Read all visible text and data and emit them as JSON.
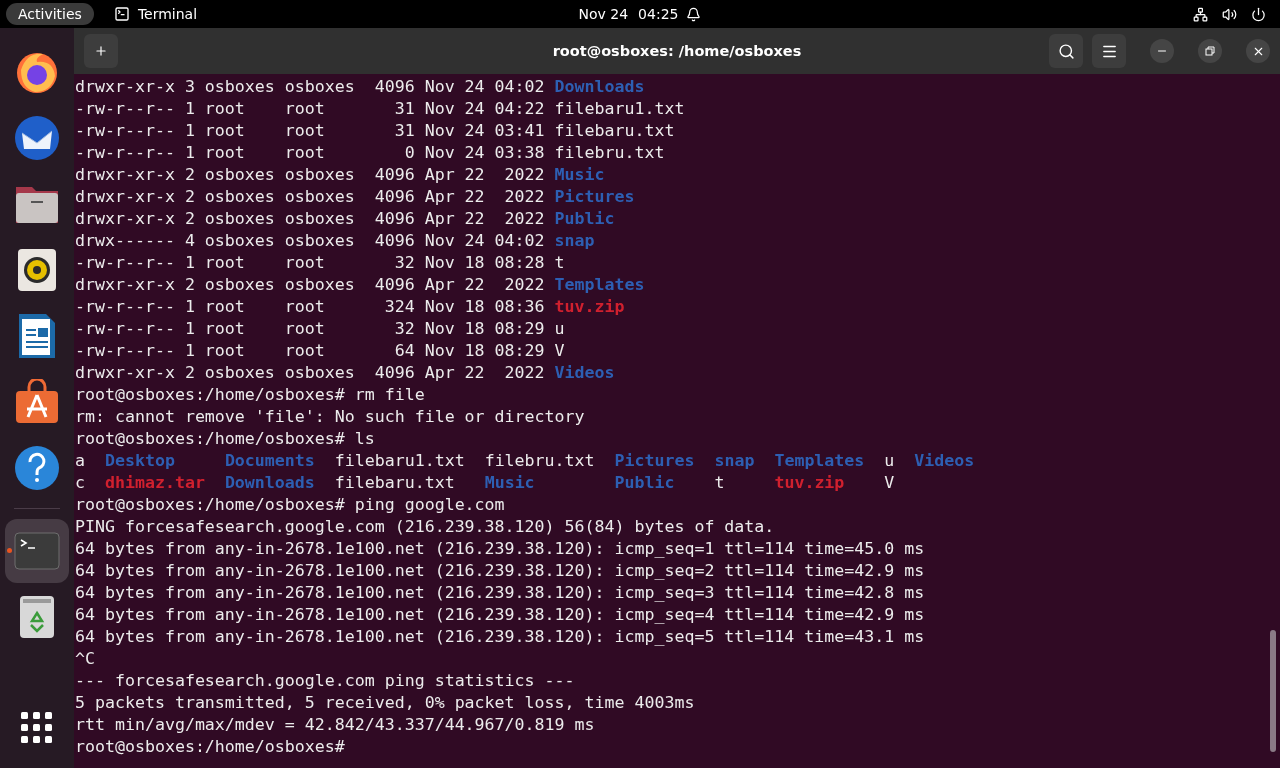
{
  "top_bar": {
    "activities": "Activities",
    "app_name": "Terminal",
    "date": "Nov 24",
    "time": "04:25"
  },
  "dock": {
    "items": [
      {
        "kind": "browser",
        "selected": false
      },
      {
        "kind": "mail",
        "selected": false
      },
      {
        "kind": "files",
        "selected": false
      },
      {
        "kind": "music",
        "selected": false
      },
      {
        "kind": "writer",
        "selected": false
      },
      {
        "kind": "store",
        "selected": false
      },
      {
        "kind": "help",
        "selected": false
      },
      {
        "kind": "terminal",
        "selected": true
      },
      {
        "kind": "trash",
        "selected": false
      }
    ]
  },
  "window": {
    "title": "root@osboxes: /home/osboxes"
  },
  "terminal": {
    "lines": [
      [
        {
          "text": "drwxr-xr-x 3 osboxes osboxes  4096 Nov 24 04:02 ",
          "kind": "plain"
        },
        {
          "text": "Downloads",
          "kind": "dir"
        }
      ],
      [
        {
          "text": "-rw-r--r-- 1 root    root       31 Nov 24 04:22 filebaru1.txt",
          "kind": "plain"
        }
      ],
      [
        {
          "text": "-rw-r--r-- 1 root    root       31 Nov 24 03:41 filebaru.txt",
          "kind": "plain"
        }
      ],
      [
        {
          "text": "-rw-r--r-- 1 root    root        0 Nov 24 03:38 filebru.txt",
          "kind": "plain"
        }
      ],
      [
        {
          "text": "drwxr-xr-x 2 osboxes osboxes  4096 Apr 22  2022 ",
          "kind": "plain"
        },
        {
          "text": "Music",
          "kind": "dir"
        }
      ],
      [
        {
          "text": "drwxr-xr-x 2 osboxes osboxes  4096 Apr 22  2022 ",
          "kind": "plain"
        },
        {
          "text": "Pictures",
          "kind": "dir"
        }
      ],
      [
        {
          "text": "drwxr-xr-x 2 osboxes osboxes  4096 Apr 22  2022 ",
          "kind": "plain"
        },
        {
          "text": "Public",
          "kind": "dir"
        }
      ],
      [
        {
          "text": "drwx------ 4 osboxes osboxes  4096 Nov 24 04:02 ",
          "kind": "plain"
        },
        {
          "text": "snap",
          "kind": "dir"
        }
      ],
      [
        {
          "text": "-rw-r--r-- 1 root    root       32 Nov 18 08:28 t",
          "kind": "plain"
        }
      ],
      [
        {
          "text": "drwxr-xr-x 2 osboxes osboxes  4096 Apr 22  2022 ",
          "kind": "plain"
        },
        {
          "text": "Templates",
          "kind": "dir"
        }
      ],
      [
        {
          "text": "-rw-r--r-- 1 root    root      324 Nov 18 08:36 ",
          "kind": "plain"
        },
        {
          "text": "tuv.zip",
          "kind": "archive"
        }
      ],
      [
        {
          "text": "-rw-r--r-- 1 root    root       32 Nov 18 08:29 u",
          "kind": "plain"
        }
      ],
      [
        {
          "text": "-rw-r--r-- 1 root    root       64 Nov 18 08:29 V",
          "kind": "plain"
        }
      ],
      [
        {
          "text": "drwxr-xr-x 2 osboxes osboxes  4096 Apr 22  2022 ",
          "kind": "plain"
        },
        {
          "text": "Videos",
          "kind": "dir"
        }
      ],
      [
        {
          "text": "root@osboxes:/home/osboxes# rm file",
          "kind": "plain"
        }
      ],
      [
        {
          "text": "rm: cannot remove 'file': No such file or directory",
          "kind": "plain"
        }
      ],
      [
        {
          "text": "root@osboxes:/home/osboxes# ls",
          "kind": "plain"
        }
      ],
      [
        {
          "text": "a  ",
          "kind": "plain"
        },
        {
          "text": "Desktop     ",
          "kind": "dir"
        },
        {
          "text": "Documents  ",
          "kind": "dir"
        },
        {
          "text": "filebaru1.txt  ",
          "kind": "plain"
        },
        {
          "text": "filebru.txt  ",
          "kind": "plain"
        },
        {
          "text": "Pictures  ",
          "kind": "dir"
        },
        {
          "text": "snap  ",
          "kind": "dir"
        },
        {
          "text": "Templates  ",
          "kind": "dir"
        },
        {
          "text": "u  ",
          "kind": "plain"
        },
        {
          "text": "Videos",
          "kind": "dir"
        }
      ],
      [
        {
          "text": "c  ",
          "kind": "plain"
        },
        {
          "text": "dhimaz.tar  ",
          "kind": "archive"
        },
        {
          "text": "Downloads  ",
          "kind": "dir"
        },
        {
          "text": "filebaru.txt   ",
          "kind": "plain"
        },
        {
          "text": "Music        ",
          "kind": "dir"
        },
        {
          "text": "Public    ",
          "kind": "dir"
        },
        {
          "text": "t     ",
          "kind": "plain"
        },
        {
          "text": "tuv.zip    ",
          "kind": "archive"
        },
        {
          "text": "V",
          "kind": "plain"
        }
      ],
      [
        {
          "text": "root@osboxes:/home/osboxes# ping google.com",
          "kind": "plain"
        }
      ],
      [
        {
          "text": "PING forcesafesearch.google.com (216.239.38.120) 56(84) bytes of data.",
          "kind": "plain"
        }
      ],
      [
        {
          "text": "64 bytes from any-in-2678.1e100.net (216.239.38.120): icmp_seq=1 ttl=114 time=45.0 ms",
          "kind": "plain"
        }
      ],
      [
        {
          "text": "64 bytes from any-in-2678.1e100.net (216.239.38.120): icmp_seq=2 ttl=114 time=42.9 ms",
          "kind": "plain"
        }
      ],
      [
        {
          "text": "64 bytes from any-in-2678.1e100.net (216.239.38.120): icmp_seq=3 ttl=114 time=42.8 ms",
          "kind": "plain"
        }
      ],
      [
        {
          "text": "64 bytes from any-in-2678.1e100.net (216.239.38.120): icmp_seq=4 ttl=114 time=42.9 ms",
          "kind": "plain"
        }
      ],
      [
        {
          "text": "64 bytes from any-in-2678.1e100.net (216.239.38.120): icmp_seq=5 ttl=114 time=43.1 ms",
          "kind": "plain"
        }
      ],
      [
        {
          "text": "^C",
          "kind": "plain"
        }
      ],
      [
        {
          "text": "--- forcesafesearch.google.com ping statistics ---",
          "kind": "plain"
        }
      ],
      [
        {
          "text": "5 packets transmitted, 5 received, 0% packet loss, time 4003ms",
          "kind": "plain"
        }
      ],
      [
        {
          "text": "rtt min/avg/max/mdev = 42.842/43.337/44.967/0.819 ms",
          "kind": "plain"
        }
      ],
      [
        {
          "text": "root@osboxes:/home/osboxes#",
          "kind": "plain"
        }
      ]
    ]
  }
}
